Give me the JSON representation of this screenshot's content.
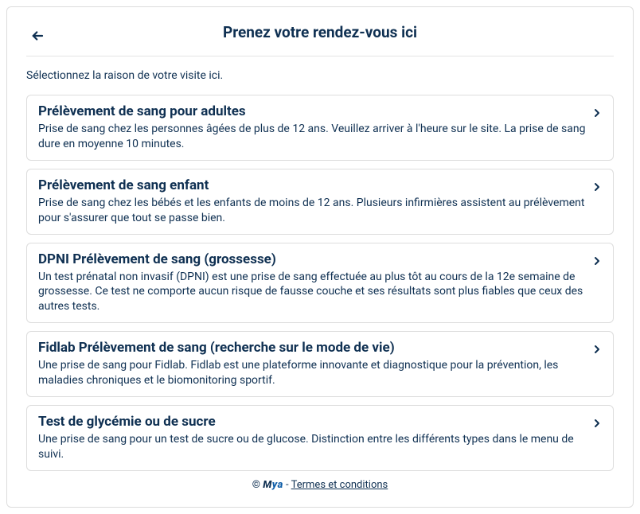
{
  "header": {
    "title": "Prenez votre rendez-vous ici"
  },
  "instruction": "Sélectionnez la raison de votre visite ici.",
  "options": [
    {
      "title": "Prélèvement de sang pour adultes",
      "desc": "Prise de sang chez les personnes âgées de plus de 12 ans. Veuillez arriver à l'heure sur le site. La prise de sang dure en moyenne 10 minutes."
    },
    {
      "title": "Prélèvement de sang enfant",
      "desc": "Prise de sang chez les bébés et les enfants de moins de 12 ans. Plusieurs infirmières assistent au prélèvement pour s'assurer que tout se passe bien."
    },
    {
      "title": "DPNI Prélèvement de sang (grossesse)",
      "desc": "Un test prénatal non invasif (DPNI) est une prise de sang effectuée au plus tôt au cours de la 12e semaine de grossesse. Ce test ne comporte aucun risque de fausse couche et ses résultats sont plus fiables que ceux des autres tests."
    },
    {
      "title": "Fidlab Prélèvement de sang (recherche sur le mode de vie)",
      "desc": "Une prise de sang pour Fidlab. Fidlab est une plateforme innovante et diagnostique pour la prévention, les maladies chroniques et le biomonitoring sportif."
    },
    {
      "title": "Test de glycémie ou de sucre",
      "desc": "Une prise de sang pour un test de sucre ou de glucose. Distinction entre les différents types dans le menu de suivi."
    }
  ],
  "footer": {
    "copy": "©",
    "brand_m": "M",
    "brand_rest": "ya",
    "dash": " - ",
    "terms": "Termes et conditions"
  }
}
